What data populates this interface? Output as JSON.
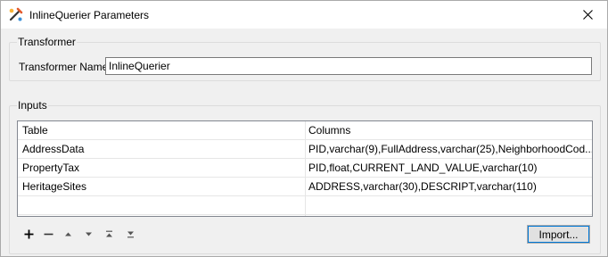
{
  "window": {
    "title": "InlineQuerier Parameters"
  },
  "transformer_group": {
    "label": "Transformer",
    "name_label": "Transformer Name:",
    "name_value": "InlineQuerier"
  },
  "inputs_group": {
    "label": "Inputs",
    "columns": [
      "Table",
      "Columns"
    ],
    "rows": [
      {
        "table": "AddressData",
        "columns": "PID,varchar(9),FullAddress,varchar(25),NeighborhoodCod..."
      },
      {
        "table": "PropertyTax",
        "columns": "PID,float,CURRENT_LAND_VALUE,varchar(10)"
      },
      {
        "table": "HeritageSites",
        "columns": "ADDRESS,varchar(30),DESCRIPT,varchar(110)"
      },
      {
        "table": "",
        "columns": ""
      }
    ],
    "toolbar": {
      "add_icon": "plus-icon",
      "remove_icon": "minus-icon",
      "up_icon": "arrow-up-icon",
      "down_icon": "arrow-down-icon",
      "top_icon": "move-top-icon",
      "bottom_icon": "move-bottom-icon"
    },
    "import_label": "Import..."
  },
  "colors": {
    "accent": "#0078d7",
    "border": "#828790",
    "background": "#f0f0f0"
  }
}
